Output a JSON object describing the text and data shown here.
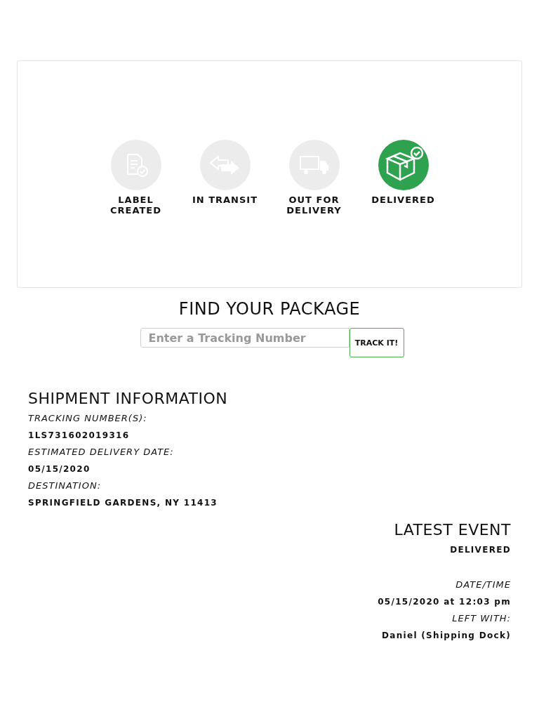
{
  "steps": [
    {
      "kind": "label",
      "label": "LABEL\nCREATED",
      "selected": false
    },
    {
      "kind": "transit",
      "label": "IN TRANSIT",
      "selected": false
    },
    {
      "kind": "truck",
      "label": "OUT FOR\nDELIVERY",
      "selected": false
    },
    {
      "kind": "box",
      "label": "DELIVERED",
      "selected": true
    }
  ],
  "finder": {
    "title": "FIND YOUR PACKAGE",
    "placeholder": "Enter a Tracking Number",
    "button": "TRACK IT!"
  },
  "shipment": {
    "title": "SHIPMENT INFORMATION",
    "fields": [
      {
        "label": "TRACKING NUMBER(S):",
        "value": "1LS731602019316"
      },
      {
        "label": "ESTIMATED DELIVERY DATE:",
        "value": "05/15/2020"
      },
      {
        "label": "DESTINATION:",
        "value": "SPRINGFIELD GARDENS, NY 11413"
      }
    ]
  },
  "latest_event": {
    "title": "LATEST EVENT",
    "status": "DELIVERED",
    "fields": [
      {
        "label": "DATE/TIME",
        "value": "05/15/2020 at 12:03 pm"
      },
      {
        "label": "LEFT WITH:",
        "value": "Daniel (Shipping Dock)"
      }
    ]
  }
}
